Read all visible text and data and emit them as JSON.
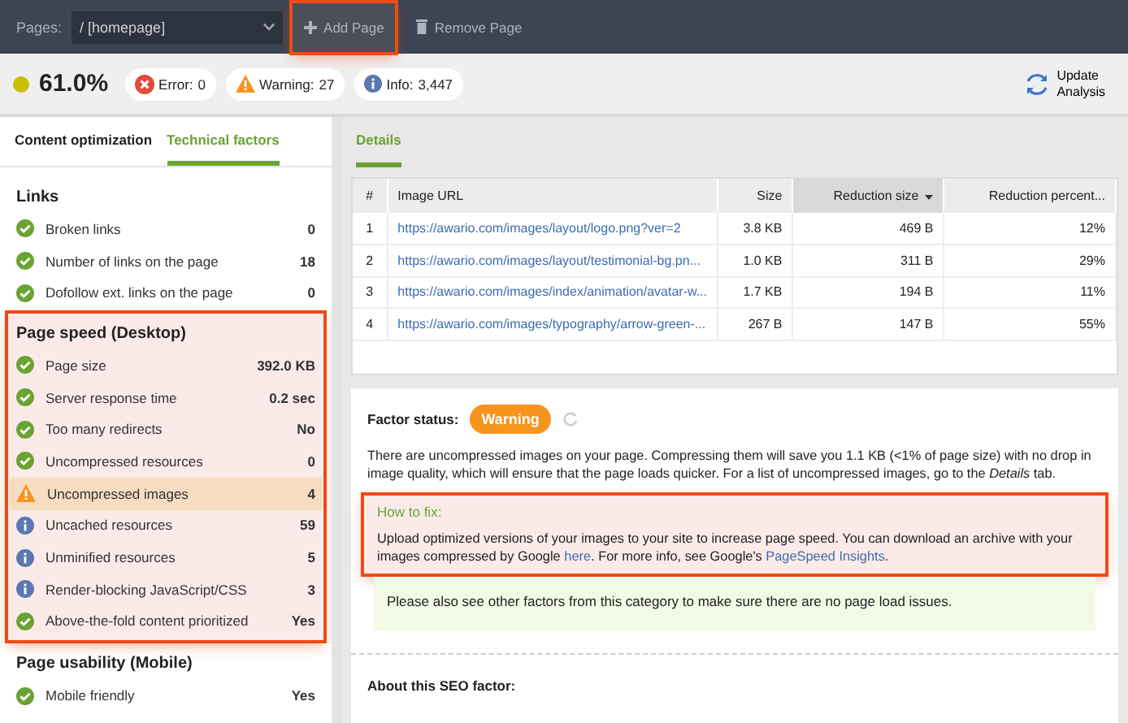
{
  "toolbar": {
    "pages_label": "Pages:",
    "page_select": "/ [homepage]",
    "buttons": [
      {
        "label": "Add Page",
        "kind": "add",
        "highlighted": true
      },
      {
        "label": "Remove Page",
        "kind": "remove",
        "highlighted": false
      }
    ]
  },
  "summary": {
    "score": {
      "text": "61.0%",
      "color": "#c8c000"
    },
    "pills": [
      {
        "kind": "error",
        "label": "Error:",
        "count": "0"
      },
      {
        "kind": "warning",
        "label": "Warning:",
        "count": "27"
      },
      {
        "kind": "info",
        "label": "Info:",
        "count": "3,447"
      }
    ],
    "update_button": [
      "Update",
      "Analysis"
    ]
  },
  "left_tabs": [
    {
      "label": "Content optimization",
      "selected": false
    },
    {
      "label": "Technical factors",
      "selected": true
    }
  ],
  "sections": [
    {
      "title": "Links",
      "highlighted": false,
      "items": [
        {
          "kind": "ok",
          "name": "Broken links",
          "value": "0",
          "selected": false
        },
        {
          "kind": "ok",
          "name": "Number of links on the page",
          "value": "18",
          "selected": false
        },
        {
          "kind": "ok",
          "name": "Dofollow ext. links on the page",
          "value": "0",
          "selected": false
        }
      ]
    },
    {
      "title": "Page speed (Desktop)",
      "highlighted": true,
      "items": [
        {
          "kind": "ok",
          "name": "Page size",
          "value": "392.0 KB",
          "selected": false
        },
        {
          "kind": "ok",
          "name": "Server response time",
          "value": "0.2 sec",
          "selected": false
        },
        {
          "kind": "ok",
          "name": "Too many redirects",
          "value": "No",
          "selected": false
        },
        {
          "kind": "ok",
          "name": "Uncompressed resources",
          "value": "0",
          "selected": false
        },
        {
          "kind": "warning",
          "name": "Uncompressed images",
          "value": "4",
          "selected": true
        },
        {
          "kind": "info",
          "name": "Uncached resources",
          "value": "59",
          "selected": false
        },
        {
          "kind": "info",
          "name": "Unminified resources",
          "value": "5",
          "selected": false
        },
        {
          "kind": "info",
          "name": "Render-blocking JavaScript/CSS",
          "value": "3",
          "selected": false
        },
        {
          "kind": "ok",
          "name": "Above-the-fold content prioritized",
          "value": "Yes",
          "selected": false
        }
      ]
    },
    {
      "title": "Page usability (Mobile)",
      "highlighted": false,
      "items": [
        {
          "kind": "ok",
          "name": "Mobile friendly",
          "value": "Yes",
          "selected": false
        }
      ]
    }
  ],
  "right_tabs": [
    {
      "label": "Details",
      "selected": true
    }
  ],
  "table": {
    "columns": [
      {
        "label": "#",
        "sorted": false
      },
      {
        "label": "Image URL",
        "sorted": false
      },
      {
        "label": "Size",
        "sorted": false
      },
      {
        "label": "Reduction size",
        "sorted": true
      },
      {
        "label": "Reduction percent...",
        "sorted": false
      }
    ],
    "rows": [
      [
        "1",
        "https://awario.com/images/layout/logo.png?ver=2",
        "3.8 KB",
        "469 B",
        "12%"
      ],
      [
        "2",
        "https://awario.com/images/layout/testimonial-bg.pn...",
        "1.0 KB",
        "311 B",
        "29%"
      ],
      [
        "3",
        "https://awario.com/images/index/animation/avatar-w...",
        "1.7 KB",
        "194 B",
        "11%"
      ],
      [
        "4",
        "https://awario.com/images/typography/arrow-green-...",
        "267 B",
        "147 B",
        "55%"
      ]
    ]
  },
  "factor": {
    "status_label": "Factor status:",
    "status": "Warning",
    "kind": "warning",
    "description": "There are uncompressed images on your page. Compressing them will save you 1.1 KB (<1% of page size) with no drop in image quality, which will ensure that the page loads quicker. For a list of uncompressed images, go to the *Details* tab.",
    "how_to_fix": {
      "title": "How to fix:",
      "highlighted": true,
      "parts": [
        {
          "kind": "text",
          "text": "Upload optimized versions of your images to your site to increase page speed. You can download an archive with your images compressed by Google "
        },
        {
          "kind": "link",
          "text": "here"
        },
        {
          "kind": "text",
          "text": ". For more info, see Google's "
        },
        {
          "kind": "link",
          "text": "PageSpeed Insights"
        },
        {
          "kind": "text",
          "text": "."
        }
      ]
    },
    "note": "Please also see other factors from this category to make sure there are no page load issues.",
    "about_title": "About this SEO factor:"
  }
}
